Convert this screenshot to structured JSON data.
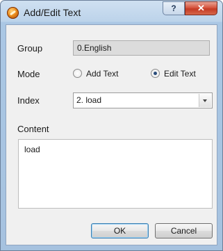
{
  "window": {
    "title": "Add/Edit Text"
  },
  "titlebar": {
    "help_label": "?",
    "close_label": "✕"
  },
  "form": {
    "group_label": "Group",
    "group_value": "0.English",
    "mode_label": "Mode",
    "mode_options": [
      {
        "label": "Add Text",
        "checked": false
      },
      {
        "label": "Edit Text",
        "checked": true
      }
    ],
    "index_label": "Index",
    "index_value": "2. load",
    "content_label": "Content",
    "content_value": "load"
  },
  "buttons": {
    "ok_label": "OK",
    "cancel_label": "Cancel"
  },
  "colors": {
    "close_button": "#c43a24",
    "titlebar": "#bcd3ea",
    "client": "#f0f0f0"
  }
}
